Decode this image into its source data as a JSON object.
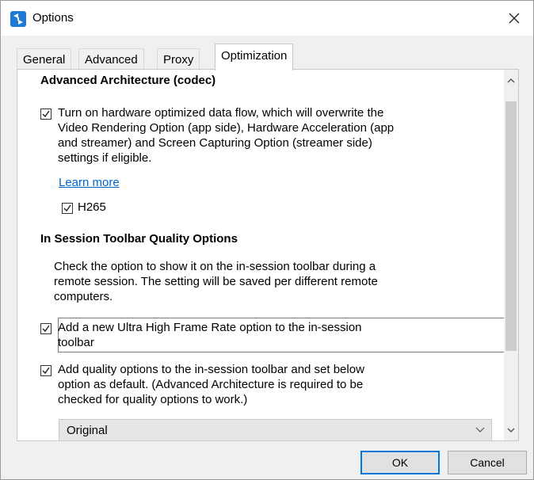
{
  "window": {
    "title": "Options",
    "close_icon": "close-icon",
    "app_icon": "options-app-icon",
    "accent_color": "#0078d7"
  },
  "tabs": [
    {
      "label": "General",
      "active": false
    },
    {
      "label": "Advanced",
      "active": false
    },
    {
      "label": "Proxy",
      "active": false
    },
    {
      "label": "Optimization",
      "active": true
    }
  ],
  "codec_section": {
    "title": "Advanced Architecture (codec)",
    "hw_flow": {
      "checked": true,
      "label_lines": [
        "Turn on hardware optimized data flow, which will overwrite the",
        "Video Rendering Option (app side), Hardware Acceleration (app",
        "and streamer) and Screen Capturing Option (streamer side)",
        "settings if eligible."
      ]
    },
    "learn_more": "Learn more",
    "h265": {
      "checked": true,
      "label": "H265"
    }
  },
  "toolbar_section": {
    "title": "In Session Toolbar Quality Options",
    "description_lines": [
      "Check the option to show it on the in-session toolbar during a",
      "remote session. The setting will be saved per different remote",
      "computers."
    ],
    "ultra_fps": {
      "checked": true,
      "label_lines": [
        "Add a new Ultra High Frame Rate option to the in-session",
        "toolbar"
      ]
    },
    "quality_options": {
      "checked": true,
      "label_lines": [
        "Add quality options to the in-session toolbar and set below",
        "option as default. (Advanced Architecture is required to be",
        "checked for quality options to work.)"
      ]
    },
    "quality_dropdown": {
      "selected": "Original"
    }
  },
  "buttons": {
    "ok": "OK",
    "cancel": "Cancel"
  }
}
